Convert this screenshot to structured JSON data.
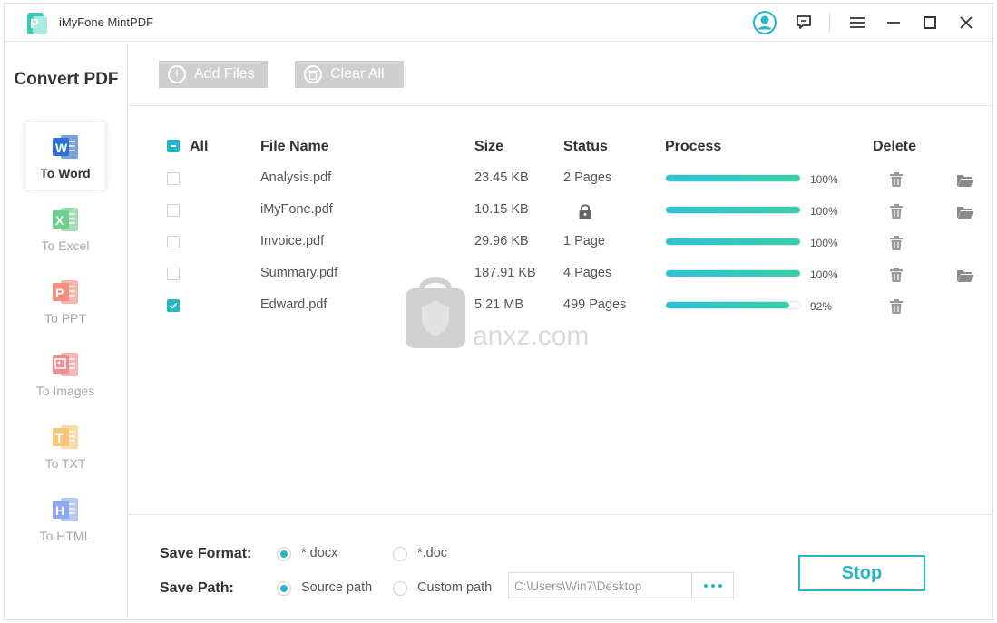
{
  "app": {
    "title": "iMyFone MintPDF"
  },
  "sidebar": {
    "title": "Convert PDF",
    "items": [
      {
        "label": "To Word",
        "icon": "word-icon",
        "letter": "W",
        "color": "#2e6fd1",
        "active": true
      },
      {
        "label": "To Excel",
        "icon": "excel-icon",
        "letter": "X",
        "color": "#6ecf8d",
        "active": false
      },
      {
        "label": "To PPT",
        "icon": "ppt-icon",
        "letter": "P",
        "color": "#f28f7e",
        "active": false
      },
      {
        "label": "To Images",
        "icon": "image-icon",
        "letter": "",
        "color": "#ef8f92",
        "active": false
      },
      {
        "label": "To TXT",
        "icon": "txt-icon",
        "letter": "T",
        "color": "#f6c77b",
        "active": false
      },
      {
        "label": "To HTML",
        "icon": "html-icon",
        "letter": "H",
        "color": "#8ea9ec",
        "active": false
      }
    ]
  },
  "toolbar": {
    "add_label": "Add Files",
    "clear_label": "Clear All"
  },
  "table": {
    "headers": {
      "all": "All",
      "name": "File Name",
      "size": "Size",
      "status": "Status",
      "process": "Process",
      "delete": "Delete"
    },
    "rows": [
      {
        "name": "Analysis.pdf",
        "size": "23.45 KB",
        "status": "2 Pages",
        "locked": false,
        "progress": 100,
        "pct": "100%",
        "checked": false,
        "folder": true
      },
      {
        "name": "iMyFone.pdf",
        "size": "10.15 KB",
        "status": "",
        "locked": true,
        "progress": 100,
        "pct": "100%",
        "checked": false,
        "folder": true
      },
      {
        "name": "Invoice.pdf",
        "size": "29.96 KB",
        "status": "1 Page",
        "locked": false,
        "progress": 100,
        "pct": "100%",
        "checked": false,
        "folder": false
      },
      {
        "name": "Summary.pdf",
        "size": "187.91 KB",
        "status": "4 Pages",
        "locked": false,
        "progress": 100,
        "pct": "100%",
        "checked": false,
        "folder": true
      },
      {
        "name": "Edward.pdf",
        "size": "5.21 MB",
        "status": "499 Pages",
        "locked": false,
        "progress": 92,
        "pct": "92%",
        "checked": true,
        "folder": false
      }
    ]
  },
  "bottom": {
    "format_label": "Save Format:",
    "format_options": [
      "*.docx",
      "*.doc"
    ],
    "path_label": "Save Path:",
    "path_options": [
      "Source path",
      "Custom path"
    ],
    "path_value": "C:\\Users\\Win7\\Desktop",
    "stop_label": "Stop"
  },
  "watermark": {
    "text": "anxz.com"
  },
  "colors": {
    "accent": "#26b6c6"
  }
}
